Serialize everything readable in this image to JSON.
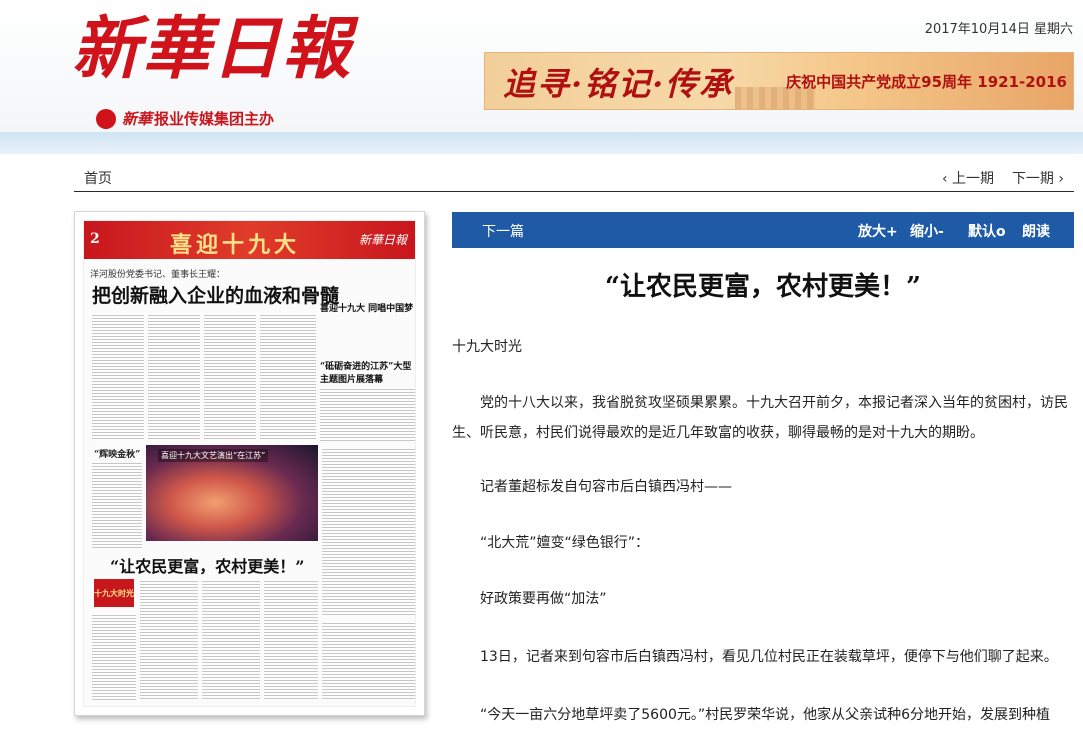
{
  "header": {
    "logo_text": "新華日報",
    "sub_brand": "新華",
    "sub_text": "报业传媒集团主办",
    "date": "2017年10月14日  星期六",
    "banner_slogan": "追寻·铭记·传承",
    "banner_anniv": "庆祝中国共产党成立95周年 1921-2016"
  },
  "nav": {
    "home": "首页",
    "prev_issue": "‹ 上一期",
    "next_issue": "下一期 ›"
  },
  "newspaper": {
    "page_number": "2",
    "page_section": "喜迎十九大",
    "page_logo": "新華日報",
    "subheading": "洋河股份党委书记、董事长王耀：",
    "headline": "把创新融入企业的血液和骨髓",
    "right_headline": "喜迎十九大 同唱中国梦",
    "right_headline_2": "“砥砺奋进的江苏”大型主题图片展落幕",
    "photo_caption": "喜迎十九大文艺演出“在江苏”",
    "photo_label": "“辉映金秋”",
    "second_headline": "“让农民更富，农村更美！”",
    "badge": "十九大时光"
  },
  "toolbar": {
    "next_article": "下一篇",
    "zoom_in": "放大+",
    "zoom_out": "缩小-",
    "default": "默认o",
    "read_aloud": "朗读"
  },
  "article": {
    "title": "“让农民更富，农村更美！”",
    "paragraphs": [
      "十九大时光",
      "　　党的十八大以来，我省脱贫攻坚硕果累累。十九大召开前夕，本报记者深入当年的贫困村，访民生、听民意，村民们说得最欢的是近几年致富的收获，聊得最畅的是对十九大的期盼。",
      "　　记者董超标发自句容市后白镇西冯村——",
      "　　“北大荒”嬗变“绿色银行”：",
      "　　好政策要再做“加法”",
      "　　13日，记者来到句容市后白镇西冯村，看见几位村民正在装载草坪，便停下与他们聊了起来。",
      "　　“今天一亩六分地草坪卖了5600元。”村民罗荣华说，他家从父亲试种6分地开始，发展到种植"
    ]
  },
  "colors": {
    "brand_red": "#d0121b",
    "toolbar_blue": "#1f5aa6"
  }
}
